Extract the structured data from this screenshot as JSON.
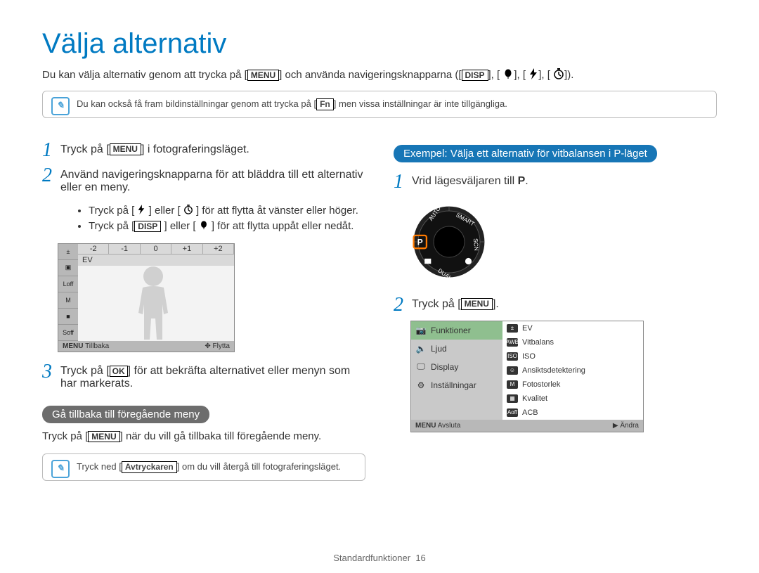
{
  "title": "Välja alternativ",
  "intro": {
    "prefix": "Du kan välja alternativ genom att trycka på [",
    "menu": "MENU",
    "mid1": "] och använda navigeringsknapparna ([",
    "disp": "DISP",
    "mid2": "], [",
    "mid3": "], [",
    "mid4": "], [",
    "end": "])."
  },
  "note1": {
    "pre": "Du kan också få fram bildinställningar genom att trycka på [",
    "fn": "Fn",
    "post": "] men vissa inställningar är inte tillgängliga."
  },
  "left": {
    "step1": {
      "num": "1",
      "pre": "Tryck på [",
      "menu": "MENU",
      "post": "] i fotograferingsläget."
    },
    "step2": {
      "num": "2",
      "text": "Använd navigeringsknapparna för att bläddra till ett alternativ eller en meny."
    },
    "sub": {
      "a_pre": "Tryck på [",
      "a_mid": "] eller [",
      "a_post": "] för att flytta åt vänster eller höger.",
      "b_pre": "Tryck på [",
      "b_disp": "DISP",
      "b_mid": "] eller [",
      "b_post": "] för att flytta uppåt eller nedåt."
    },
    "lcd": {
      "scale": [
        "-2",
        "-1",
        "0",
        "+1",
        "+2"
      ],
      "ev_label": "EV",
      "side": [
        "±",
        "▣",
        "Loff",
        "M",
        "■",
        "Soff"
      ],
      "bottom_left_key": "MENU",
      "bottom_left": "Tillbaka",
      "bottom_right": "Flytta"
    },
    "step3": {
      "num": "3",
      "pre": "Tryck på [",
      "ok": "OK",
      "post": "] för att bekräfta alternativet eller menyn som har markerats."
    },
    "back_pill": "Gå tillbaka till föregående meny",
    "back_line": {
      "pre": "Tryck på [",
      "menu": "MENU",
      "post": "] när du vill gå tillbaka till föregående meny."
    },
    "note2": {
      "pre": "Tryck ned [",
      "shutter": "Avtryckaren",
      "post": "] om du vill återgå till fotograferingsläget."
    }
  },
  "right": {
    "example_pill": "Exempel: Välja ett alternativ för vitbalansen i P-läget",
    "step1": {
      "num": "1",
      "pre": "Vrid lägesväljaren till ",
      "mode": "P",
      "post": "."
    },
    "dial_labels": [
      "AUTO",
      "SMART",
      "SCN",
      "DUAL",
      "P"
    ],
    "step2": {
      "num": "2",
      "pre": "Tryck på [",
      "menu": "MENU",
      "post": "]."
    },
    "menu": {
      "left_items": [
        "Funktioner",
        "Ljud",
        "Display",
        "Inställningar"
      ],
      "right_items": [
        "EV",
        "Vitbalans",
        "ISO",
        "Ansiktsdetektering",
        "Fotostorlek",
        "Kvalitet",
        "ACB"
      ],
      "right_icons": [
        "±",
        "AWB",
        "ISO",
        "☺",
        "M",
        "▦",
        "Aoff"
      ],
      "bottom_left_key": "MENU",
      "bottom_left": "Avsluta",
      "bottom_right_arrow": "▶",
      "bottom_right": "Ändra"
    }
  },
  "footer": {
    "label": "Standardfunktioner",
    "page": "16"
  }
}
